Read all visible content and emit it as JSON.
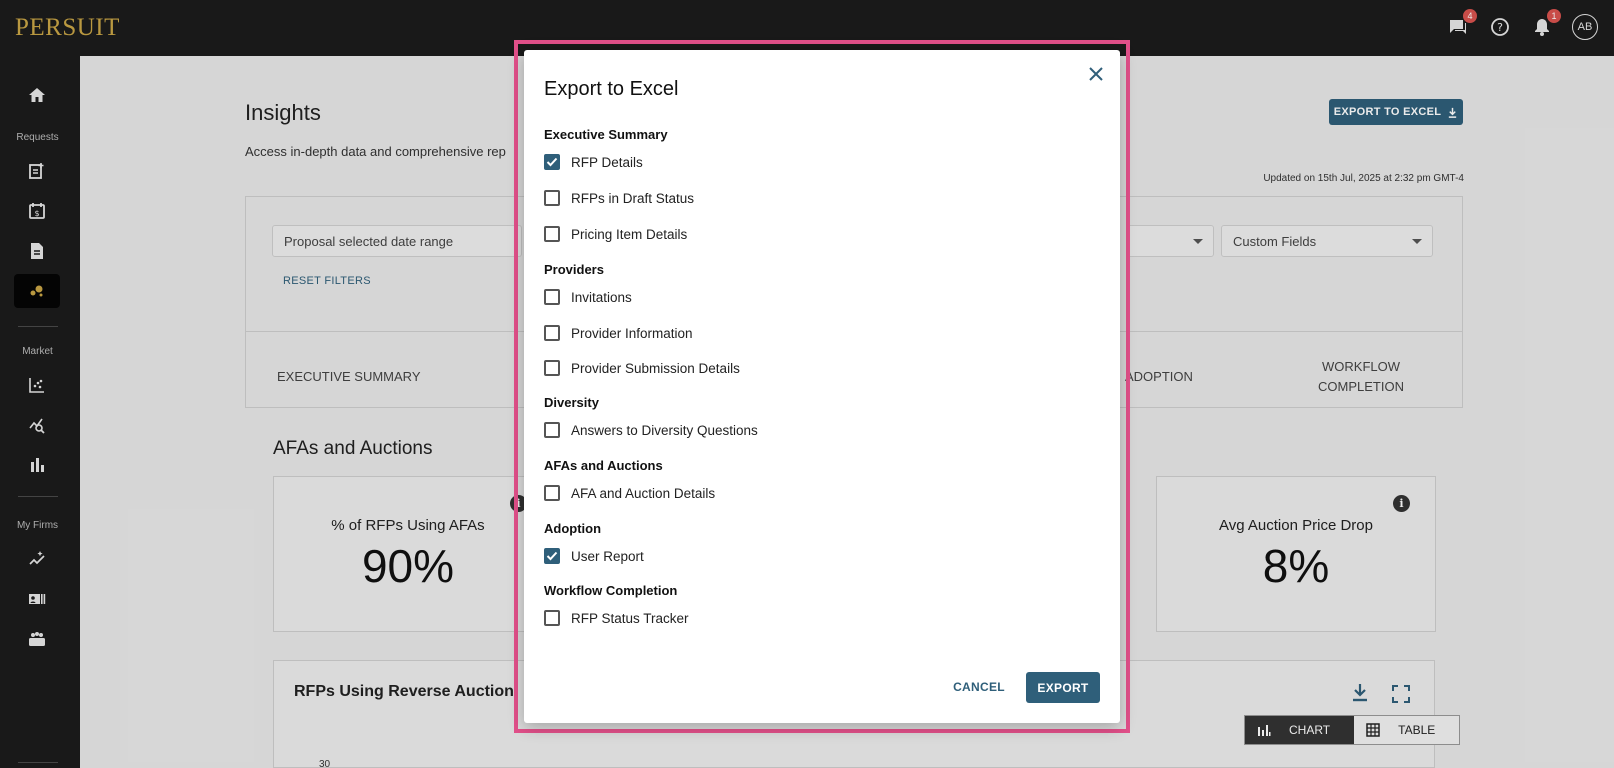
{
  "brand": {
    "logo_text": "PERSUIT"
  },
  "topbar": {
    "messages_badge": "4",
    "notifications_badge": "1",
    "avatar_initials": "AB"
  },
  "sidebar": {
    "section_requests": "Requests",
    "section_market": "Market",
    "section_my_firms": "My Firms"
  },
  "page": {
    "title": "Insights",
    "subtitle": "Access in-depth data and comprehensive rep",
    "export_button": "EXPORT TO EXCEL",
    "updated": "Updated on 15th Jul, 2025 at 2:32 pm GMT-4",
    "filters": {
      "date_range": "Proposal selected date range",
      "custom_fields": "Custom Fields",
      "reset": "RESET FILTERS"
    },
    "tabs": {
      "executive_summary": "EXECUTIVE SUMMARY",
      "adoption_partial": "ADOPTION",
      "workflow_line1": "WORKFLOW",
      "workflow_line2": "COMPLETION"
    },
    "section_title": "AFAs and Auctions",
    "cards": [
      {
        "label": "% of RFPs Using AFAs",
        "value": "90%"
      },
      {
        "label": "Avg Auction Price Drop",
        "value": "8%"
      }
    ],
    "chart_panel": {
      "title": "RFPs Using Reverse Auction",
      "chart_label": "CHART",
      "table_label": "TABLE",
      "ytick_top": "30"
    }
  },
  "dialog": {
    "title": "Export to Excel",
    "groups": [
      {
        "heading": "Executive Summary",
        "options": [
          {
            "label": "RFP Details",
            "checked": true
          },
          {
            "label": "RFPs in Draft Status",
            "checked": false
          },
          {
            "label": "Pricing Item Details",
            "checked": false
          }
        ]
      },
      {
        "heading": "Providers",
        "options": [
          {
            "label": "Invitations",
            "checked": false
          },
          {
            "label": "Provider Information",
            "checked": false
          },
          {
            "label": "Provider Submission Details",
            "checked": false
          }
        ]
      },
      {
        "heading": "Diversity",
        "options": [
          {
            "label": "Answers to Diversity Questions",
            "checked": false
          }
        ]
      },
      {
        "heading": "AFAs and Auctions",
        "options": [
          {
            "label": "AFA and Auction Details",
            "checked": false
          }
        ]
      },
      {
        "heading": "Adoption",
        "options": [
          {
            "label": "User Report",
            "checked": true
          }
        ]
      },
      {
        "heading": "Workflow Completion",
        "options": [
          {
            "label": "RFP Status Tracker",
            "checked": false
          }
        ]
      }
    ],
    "cancel_label": "CANCEL",
    "export_label": "EXPORT"
  }
}
